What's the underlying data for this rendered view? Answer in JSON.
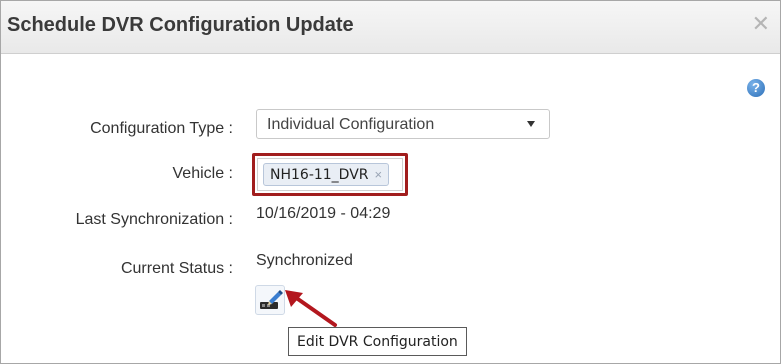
{
  "dialog": {
    "title": "Schedule DVR Configuration Update",
    "close_icon": "close-icon",
    "help_icon": "help-icon",
    "help_glyph": "?"
  },
  "form": {
    "configuration_type": {
      "label": "Configuration Type :",
      "value": "Individual Configuration"
    },
    "vehicle": {
      "label": "Vehicle :",
      "tags": [
        {
          "text": "NH16-11_DVR",
          "remove": "×"
        }
      ]
    },
    "last_sync": {
      "label": "Last Synchronization :",
      "value": "10/16/2019 - 04:29"
    },
    "current_status": {
      "label": "Current Status :",
      "value": "Synchronized"
    }
  },
  "edit_action": {
    "icon": "edit-dvr-icon",
    "tooltip": "Edit DVR Configuration"
  },
  "colors": {
    "highlight_border": "#a11d1d",
    "annotation_arrow": "#b3171e",
    "help_icon": "#2d6fb8"
  }
}
